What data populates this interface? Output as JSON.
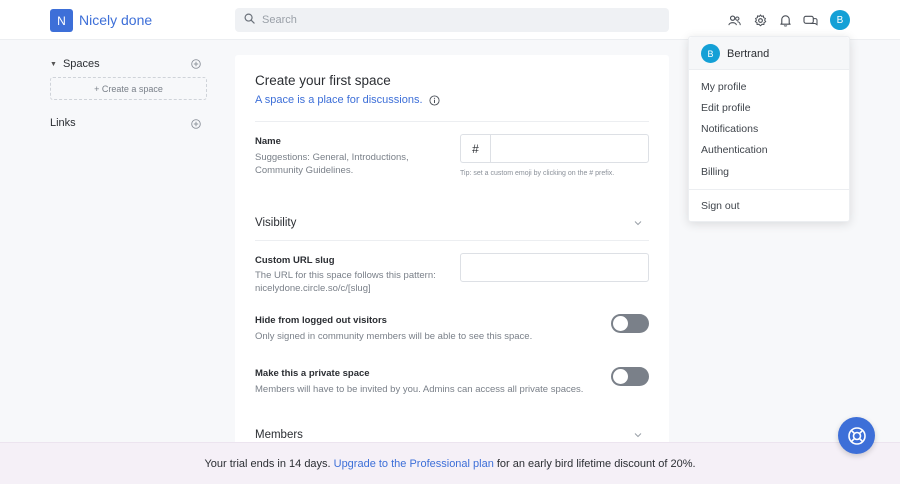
{
  "brand": {
    "badge": "N",
    "name": "Nicely done"
  },
  "search": {
    "placeholder": "Search"
  },
  "header": {
    "avatar_initial": "B",
    "icons": [
      "members-icon",
      "settings-icon",
      "bell-icon",
      "chat-icon"
    ]
  },
  "sidebar": {
    "spaces_label": "Spaces",
    "create_space": "+ Create a space",
    "links_label": "Links"
  },
  "form": {
    "title": "Create your first space",
    "subtitle": "A space is a place for discussions.",
    "name": {
      "label": "Name",
      "help": "Suggestions: General, Introductions, Community Guidelines.",
      "prefix": "#",
      "value": "",
      "tip": "Tip: set a custom emoji by clicking on the # prefix."
    },
    "visibility": {
      "heading": "Visibility"
    },
    "slug": {
      "label": "Custom URL slug",
      "help": "The URL for this space follows this pattern: nicelydone.circle.so/c/[slug]",
      "value": ""
    },
    "hide": {
      "label": "Hide from logged out visitors",
      "help": "Only signed in community members will be able to see this space.",
      "enabled": false
    },
    "private": {
      "label": "Make this a private space",
      "help": "Members will have to be invited by you. Admins can access all private spaces.",
      "enabled": false
    },
    "members": {
      "heading": "Members"
    }
  },
  "user_menu": {
    "avatar_initial": "B",
    "name": "Bertrand",
    "items": [
      "My profile",
      "Edit profile",
      "Notifications",
      "Authentication",
      "Billing"
    ],
    "sign_out": "Sign out"
  },
  "banner": {
    "prefix": "Your trial ends in 14 days.",
    "link": "Upgrade to the Professional plan",
    "suffix": "for an early bird lifetime discount of 20%."
  },
  "colors": {
    "accent": "#3d6fd8",
    "avatar": "#14a0d6",
    "toggle_off": "#7a8089",
    "banner_bg": "#f5f0f7"
  }
}
